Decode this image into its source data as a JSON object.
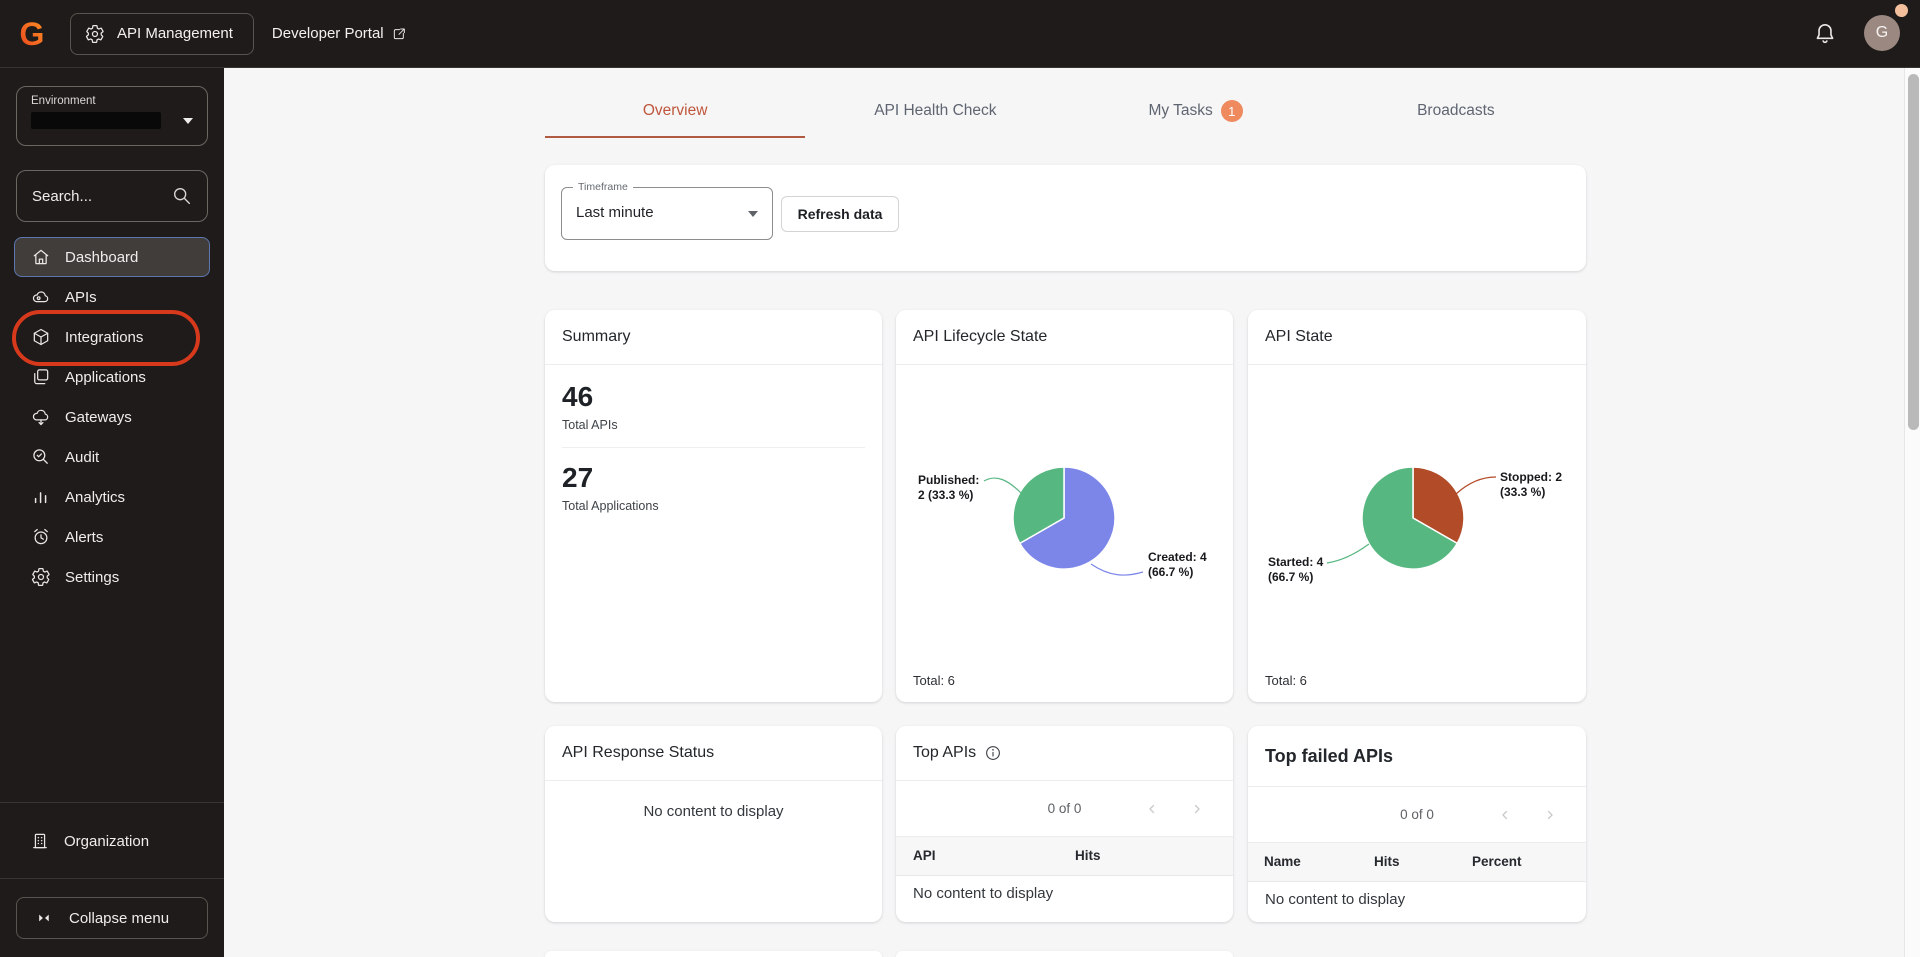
{
  "topbar": {
    "app_button_label": "API Management",
    "portal_link_label": "Developer Portal",
    "avatar_initial": "G"
  },
  "sidebar": {
    "environment_label": "Environment",
    "search_placeholder": "Search...",
    "items": [
      {
        "label": "Dashboard",
        "icon": "home-icon",
        "active": true
      },
      {
        "label": "APIs",
        "icon": "cloud-icon",
        "active": false
      },
      {
        "label": "Integrations",
        "icon": "package-icon",
        "active": false,
        "annotated": true
      },
      {
        "label": "Applications",
        "icon": "windows-icon",
        "active": false
      },
      {
        "label": "Gateways",
        "icon": "cloud-gateway-icon",
        "active": false
      },
      {
        "label": "Audit",
        "icon": "audit-search-icon",
        "active": false
      },
      {
        "label": "Analytics",
        "icon": "bar-chart-icon",
        "active": false
      },
      {
        "label": "Alerts",
        "icon": "alarm-icon",
        "active": false
      },
      {
        "label": "Settings",
        "icon": "gear-icon",
        "active": false
      }
    ],
    "organization_label": "Organization",
    "collapse_label": "Collapse menu"
  },
  "tabs": [
    {
      "label": "Overview",
      "active": true
    },
    {
      "label": "API Health Check",
      "active": false
    },
    {
      "label": "My Tasks",
      "active": false,
      "badge": "1"
    },
    {
      "label": "Broadcasts",
      "active": false
    }
  ],
  "filters": {
    "timeframe_label": "Timeframe",
    "timeframe_value": "Last minute",
    "refresh_button_label": "Refresh data"
  },
  "cards": {
    "summary": {
      "title": "Summary",
      "stats": [
        {
          "value": "46",
          "label": "Total APIs"
        },
        {
          "value": "27",
          "label": "Total Applications"
        }
      ]
    },
    "lifecycle": {
      "title": "API Lifecycle State",
      "total_label": "Total: 6"
    },
    "api_state": {
      "title": "API State",
      "total_label": "Total: 6"
    },
    "response_status": {
      "title": "API Response Status",
      "empty_text": "No content to display"
    },
    "top_apis": {
      "title": "Top APIs",
      "pagination": "0 of 0",
      "columns": [
        "API",
        "Hits"
      ],
      "empty_text": "No content to display"
    },
    "top_failed": {
      "title": "Top failed APIs",
      "pagination": "0 of 0",
      "columns": [
        "Name",
        "Hits",
        "Percent"
      ],
      "empty_text": "No content to display"
    }
  },
  "chart_data": [
    {
      "type": "pie",
      "title": "API Lifecycle State",
      "total": 6,
      "slices": [
        {
          "name": "Created",
          "value": 4,
          "percent": 66.7,
          "color": "#7b86e8",
          "label_lines": [
            "Created: 4",
            "(66.7 %)"
          ]
        },
        {
          "name": "Published",
          "value": 2,
          "percent": 33.3,
          "color": "#57b781",
          "label_lines": [
            "Published:",
            "2 (33.3 %)"
          ]
        }
      ]
    },
    {
      "type": "pie",
      "title": "API State",
      "total": 6,
      "slices": [
        {
          "name": "Stopped",
          "value": 2,
          "percent": 33.3,
          "color": "#b24b27",
          "label_lines": [
            "Stopped: 2",
            "(33.3 %)"
          ]
        },
        {
          "name": "Started",
          "value": 4,
          "percent": 66.7,
          "color": "#57b781",
          "label_lines": [
            "Started: 4",
            "(66.7 %)"
          ]
        }
      ]
    }
  ],
  "colors": {
    "accent_orange": "#bf563b",
    "badge_orange": "#ee8a5e",
    "annotation_red": "#d6391b",
    "topbar_bg": "#1e1b1a",
    "avatar_bg": "#9b8981"
  }
}
